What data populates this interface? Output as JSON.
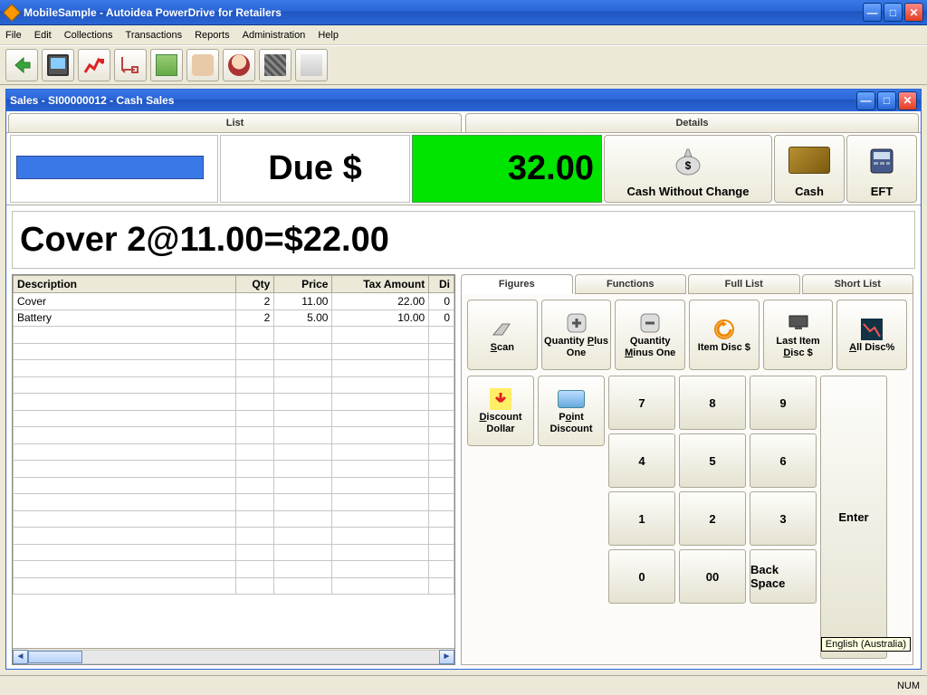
{
  "app": {
    "title": "MobileSample - Autoidea PowerDrive for Retailers",
    "menus": [
      "File",
      "Edit",
      "Collections",
      "Transactions",
      "Reports",
      "Administration",
      "Help"
    ]
  },
  "sales": {
    "title": "Sales - SI00000012 - Cash Sales",
    "tabs": {
      "list": "List",
      "details": "Details"
    },
    "due_label": "Due $",
    "due_amount": "32.00",
    "pay": {
      "cwc": "Cash Without Change",
      "cash": "Cash",
      "eft": "EFT"
    },
    "line_readout": "Cover 2@11.00=$22.00"
  },
  "table": {
    "headers": [
      "Description",
      "Qty",
      "Price",
      "Tax Amount",
      "Di"
    ],
    "rows": [
      {
        "desc": "Cover",
        "qty": "2",
        "price": "11.00",
        "tax": "22.00",
        "di": "0"
      },
      {
        "desc": "Battery",
        "qty": "2",
        "price": "5.00",
        "tax": "10.00",
        "di": "0"
      }
    ]
  },
  "subtabs": [
    "Figures",
    "Functions",
    "Full List",
    "Short List"
  ],
  "funcs": {
    "scan": "Scan",
    "qtyplus": "Quantity Plus One",
    "qtyminus": "Quantity Minus One",
    "itemdisc": "Item Disc $",
    "lastdisc": "Last Item Disc $",
    "alldisc": "All Disc%",
    "discdollar": "Discount Dollar",
    "pointdisc": "Point Discount"
  },
  "keypad": {
    "k7": "7",
    "k8": "8",
    "k9": "9",
    "k4": "4",
    "k5": "5",
    "k6": "6",
    "k1": "1",
    "k2": "2",
    "k3": "3",
    "k0": "0",
    "k00": "00",
    "bs": "Back Space",
    "enter": "Enter"
  },
  "status": {
    "num": "NUM"
  },
  "lang": "English (Australia)"
}
